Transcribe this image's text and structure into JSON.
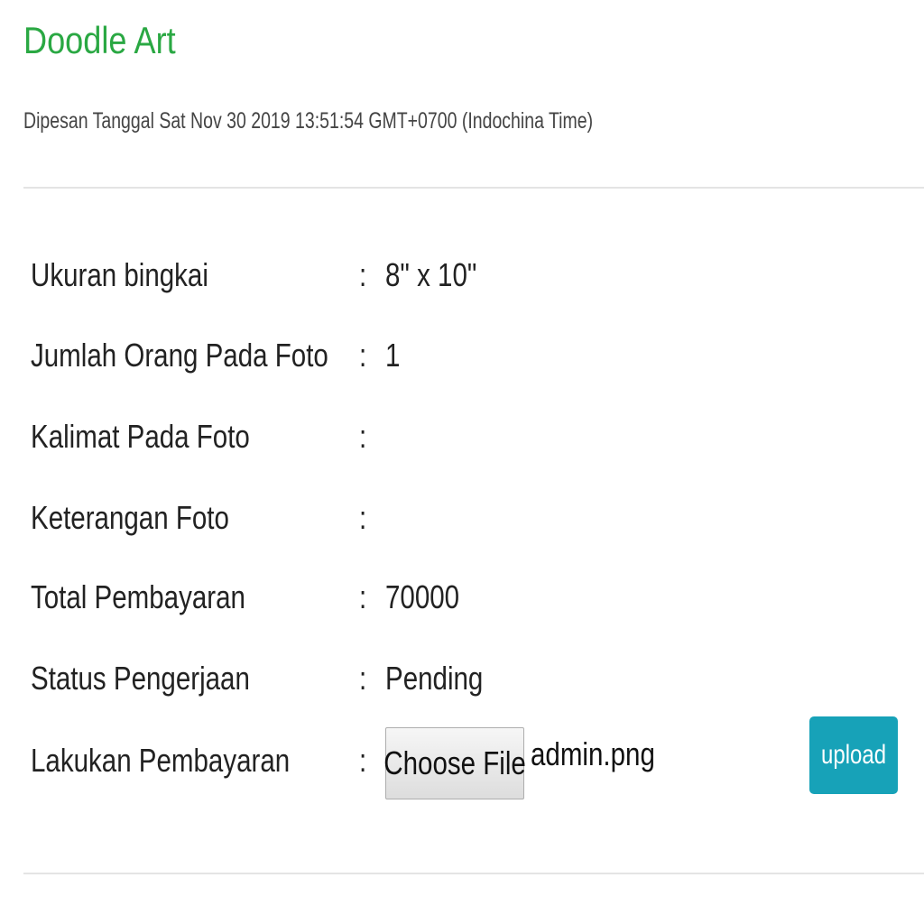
{
  "product": {
    "title": "Doodle Art",
    "ordered_text": "Dipesan Tanggal Sat Nov 30 2019 13:51:54 GMT+0700 (Indochina Time)"
  },
  "details": [
    {
      "label": "Ukuran bingkai",
      "colon": ":",
      "value": "8\" x 10\""
    },
    {
      "label": "Jumlah Orang Pada Foto",
      "colon": ":",
      "value": "1"
    },
    {
      "label": "Kalimat Pada Foto",
      "colon": ":",
      "value": ""
    },
    {
      "label": "Keterangan Foto",
      "colon": ":",
      "value": ""
    },
    {
      "label": "Total Pembayaran",
      "colon": ":",
      "value": "70000"
    },
    {
      "label": "Status Pengerjaan",
      "colon": ":",
      "value": "Pending"
    }
  ],
  "payment": {
    "label": "Lakukan Pembayaran",
    "colon": ":",
    "choose_file_label": "Choose File",
    "file_name": "admin.png",
    "upload_label": "upload"
  },
  "colors": {
    "title": "#2aa843",
    "upload_button": "#17a2b8",
    "divider": "#e4e4e4"
  }
}
